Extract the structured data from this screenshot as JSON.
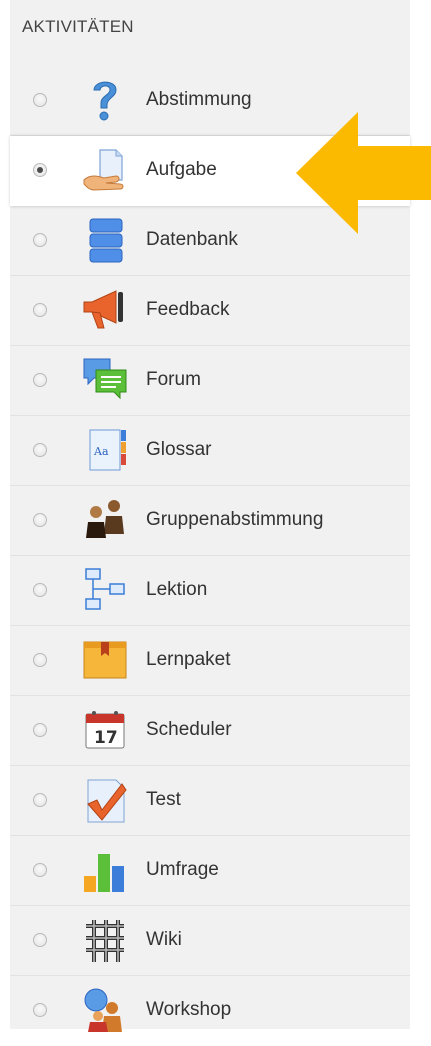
{
  "section": {
    "heading": "AKTIVITÄTEN"
  },
  "activities": [
    {
      "label": "Abstimmung",
      "icon": "question-icon",
      "selected": false
    },
    {
      "label": "Aufgabe",
      "icon": "assignment-icon",
      "selected": true
    },
    {
      "label": "Datenbank",
      "icon": "database-icon",
      "selected": false
    },
    {
      "label": "Feedback",
      "icon": "megaphone-icon",
      "selected": false
    },
    {
      "label": "Forum",
      "icon": "forum-icon",
      "selected": false
    },
    {
      "label": "Glossar",
      "icon": "glossary-icon",
      "selected": false
    },
    {
      "label": "Gruppenabstimmung",
      "icon": "group-choice-icon",
      "selected": false
    },
    {
      "label": "Lektion",
      "icon": "lesson-icon",
      "selected": false
    },
    {
      "label": "Lernpaket",
      "icon": "package-icon",
      "selected": false
    },
    {
      "label": "Scheduler",
      "icon": "calendar-icon",
      "selected": false
    },
    {
      "label": "Test",
      "icon": "quiz-icon",
      "selected": false
    },
    {
      "label": "Umfrage",
      "icon": "survey-chart-icon",
      "selected": false
    },
    {
      "label": "Wiki",
      "icon": "wiki-icon",
      "selected": false
    },
    {
      "label": "Workshop",
      "icon": "workshop-icon",
      "selected": false
    }
  ],
  "callout": {
    "icon": "arrow-left-icon",
    "color": "#fbb900"
  }
}
